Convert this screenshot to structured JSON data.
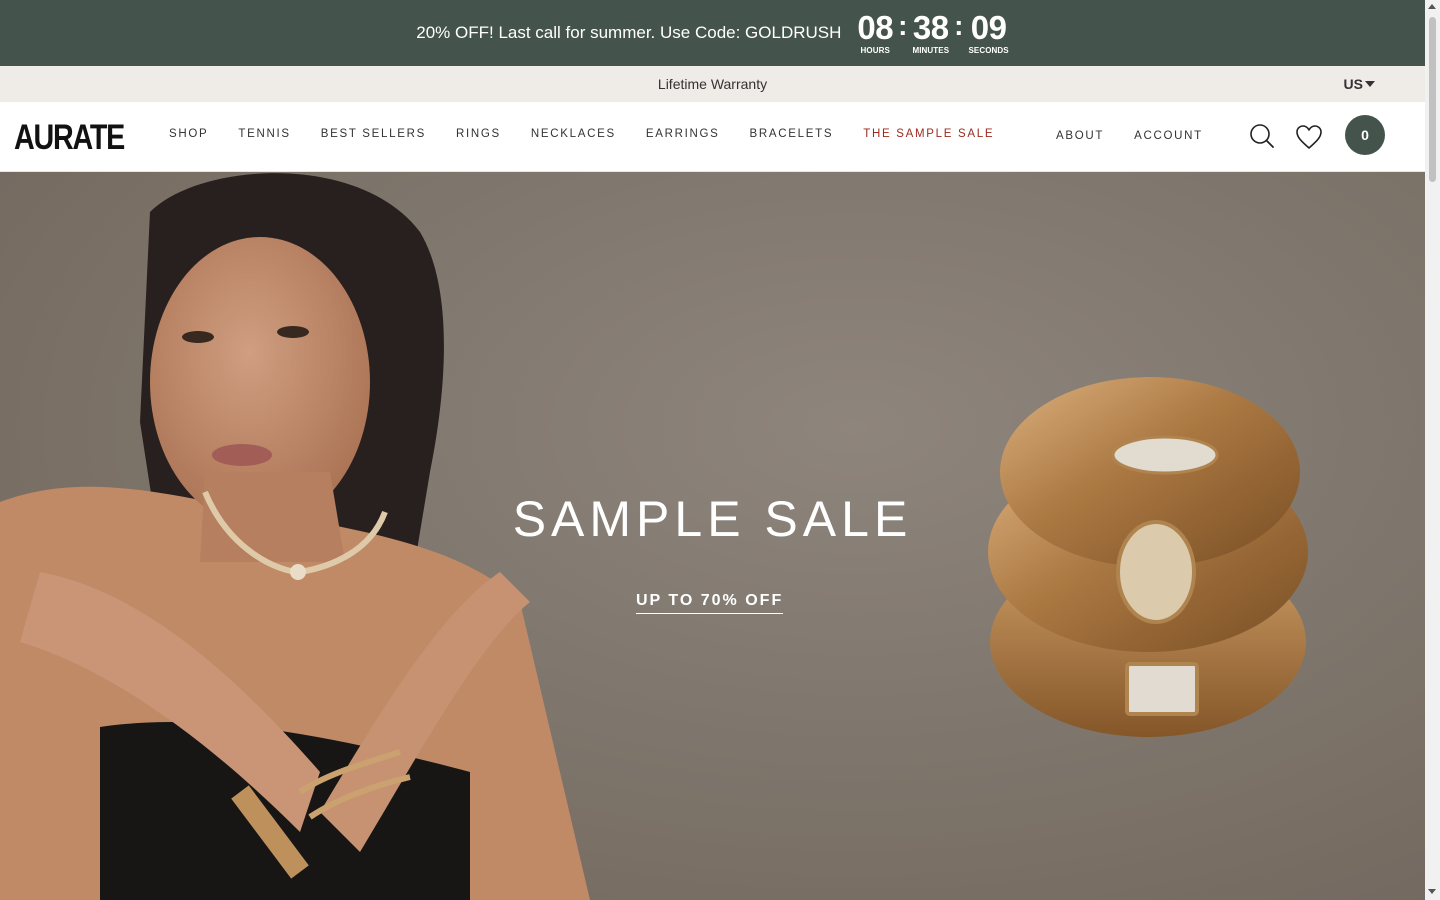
{
  "promo": {
    "text": "20% OFF! Last call for summer. Use Code: GOLDRUSH",
    "countdown": [
      {
        "value": "08",
        "label": "HOURS"
      },
      {
        "value": "38",
        "label": "MINUTES"
      },
      {
        "value": "09",
        "label": "SECONDS"
      }
    ],
    "separator": ":",
    "bg_color": "#44534c"
  },
  "warranty": {
    "text": "Lifetime Warranty",
    "locale": "US"
  },
  "header": {
    "logo": "AURATE",
    "nav": [
      {
        "label": "SHOP"
      },
      {
        "label": "TENNIS"
      },
      {
        "label": "BEST SELLERS"
      },
      {
        "label": "RINGS"
      },
      {
        "label": "NECKLACES"
      },
      {
        "label": "EARRINGS"
      },
      {
        "label": "BRACELETS"
      },
      {
        "label": "THE SAMPLE SALE"
      }
    ],
    "secondary_nav": [
      {
        "label": "ABOUT"
      },
      {
        "label": "ACCOUNT"
      }
    ],
    "icons": [
      "search-icon",
      "heart-icon"
    ],
    "cart_count": "0",
    "sale_color": "#9b2a1f"
  },
  "hero": {
    "title": "SAMPLE SALE",
    "cta": "UP TO 70% OFF"
  }
}
